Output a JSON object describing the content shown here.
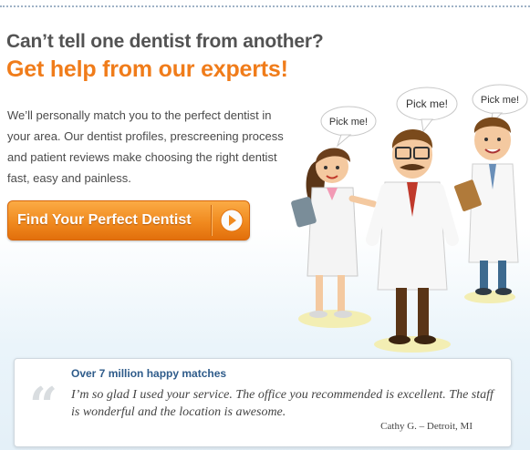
{
  "header": {
    "headline": "Can’t tell one dentist from another?",
    "subheadline": "Get help from our experts!"
  },
  "intro": {
    "text": "We’ll personally match you to the perfect dentist in your area. Our dentist profiles, prescreening process and patient reviews make choosing the right dentist fast, easy and painless."
  },
  "cta": {
    "label": "Find Your Perfect Dentist",
    "icon": "play-arrow-icon"
  },
  "illustration": {
    "bubbles": [
      "Pick me!",
      "Pick me!",
      "Pick me!"
    ]
  },
  "testimonial": {
    "title": "Over 7 million happy matches",
    "quote": "I’m so glad I used your service. The office you recommended is excellent. The staff is wonderful and the location is awesome.",
    "author": "Cathy G. – Detroit, MI",
    "quote_icon": "quote-icon"
  },
  "colors": {
    "accent": "#f07c1a",
    "title_blue": "#2e5b8a",
    "heading_gray": "#535353"
  }
}
